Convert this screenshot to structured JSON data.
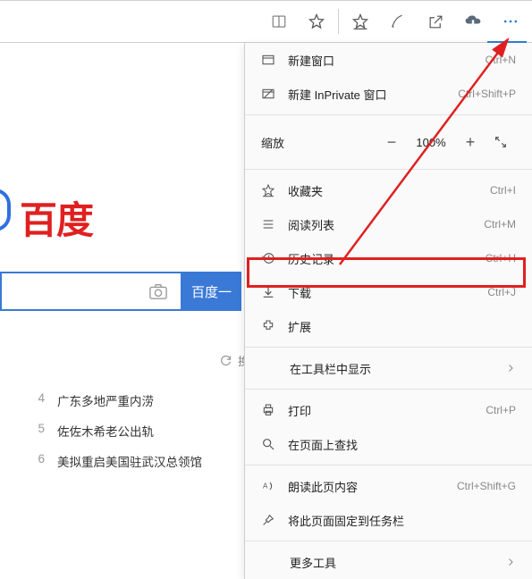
{
  "toolbar": {
    "icons": [
      "reading-view",
      "favorite-star",
      "favorites-bar",
      "ink",
      "share",
      "downloads",
      "more"
    ]
  },
  "logo_text": "百度",
  "search_button": "百度一",
  "refresh_text": "换",
  "news": [
    {
      "rank": "4",
      "title": "广东多地严重内涝"
    },
    {
      "rank": "5",
      "title": "佐佐木希老公出轨"
    },
    {
      "rank": "6",
      "title": "美拟重启美国驻武汉总领馆"
    }
  ],
  "menu": {
    "new_window": "新建窗口",
    "new_window_sc": "Ctrl+N",
    "new_inprivate": "新建 InPrivate 窗口",
    "new_inprivate_sc": "Ctrl+Shift+P",
    "zoom_label": "缩放",
    "zoom_value": "100%",
    "favorites": "收藏夹",
    "favorites_sc": "Ctrl+I",
    "reading_list": "阅读列表",
    "reading_list_sc": "Ctrl+M",
    "history": "历史记录",
    "history_sc": "Ctrl+H",
    "downloads": "下载",
    "downloads_sc": "Ctrl+J",
    "extensions": "扩展",
    "show_in_toolbar": "在工具栏中显示",
    "print": "打印",
    "print_sc": "Ctrl+P",
    "find": "在页面上查找",
    "read_aloud": "朗读此页内容",
    "read_aloud_sc": "Ctrl+Shift+G",
    "pin": "将此页面固定到任务栏",
    "more_tools": "更多工具"
  }
}
